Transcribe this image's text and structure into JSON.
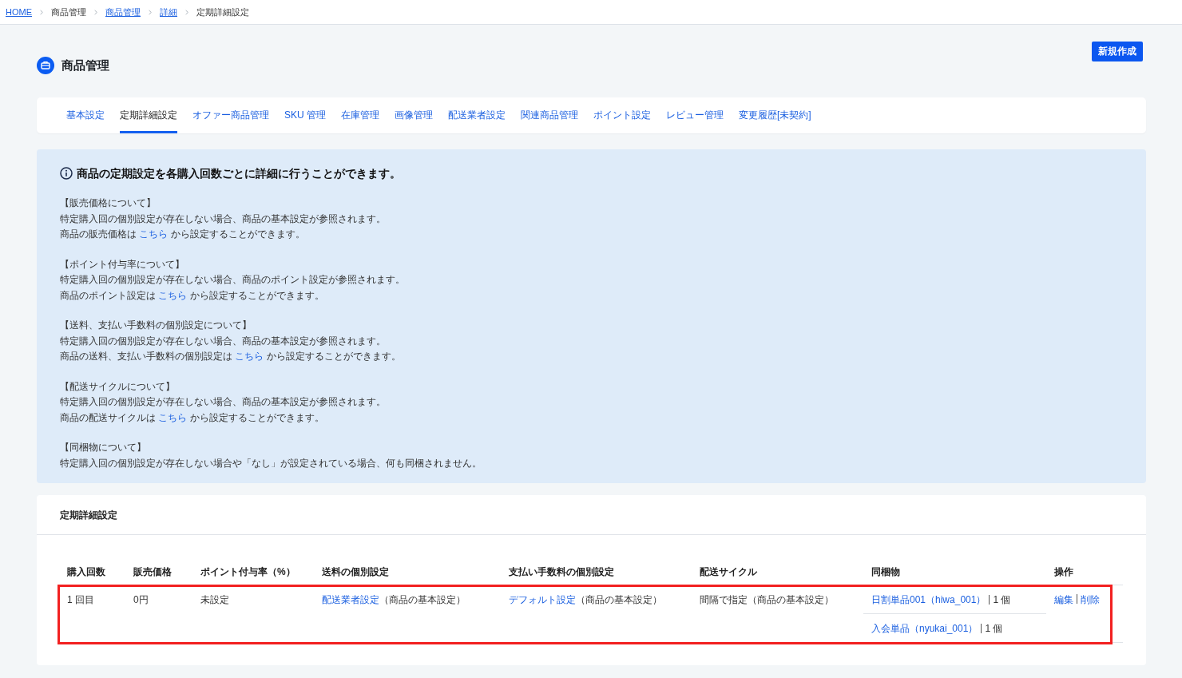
{
  "breadcrumb": [
    {
      "label": "HOME",
      "kind": "link"
    },
    {
      "label": "商品管理",
      "kind": "text"
    },
    {
      "label": "商品管理",
      "kind": "link"
    },
    {
      "label": "詳細",
      "kind": "link"
    },
    {
      "label": "定期詳細設定",
      "kind": "text"
    }
  ],
  "page_header": {
    "title": "商品管理",
    "button": "新規作成"
  },
  "tabs": [
    {
      "label": "基本設定",
      "selected": false
    },
    {
      "label": "定期詳細設定",
      "selected": true
    },
    {
      "label": "オファー商品管理",
      "selected": false
    },
    {
      "label": "SKU 管理",
      "selected": false
    },
    {
      "label": "在庫管理",
      "selected": false
    },
    {
      "label": "画像管理",
      "selected": false
    },
    {
      "label": "配送業者設定",
      "selected": false
    },
    {
      "label": "関連商品管理",
      "selected": false
    },
    {
      "label": "ポイント設定",
      "selected": false
    },
    {
      "label": "レビュー管理",
      "selected": false
    },
    {
      "label": "変更履歴[未契約]",
      "selected": false
    }
  ],
  "notice": {
    "heading": "商品の定期設定を各購入回数ごとに詳細に行うことができます。",
    "sections": [
      {
        "title": "【販売価格について】",
        "lines": [
          {
            "kind": "plain",
            "text": "特定購入回の個別設定が存在しない場合、商品の基本設定が参照されます。"
          },
          {
            "kind": "link",
            "before": "商品の販売価格は",
            "link": "こちら",
            "after": "から設定することができます。"
          }
        ]
      },
      {
        "title": "【ポイント付与率について】",
        "lines": [
          {
            "kind": "plain",
            "text": "特定購入回の個別設定が存在しない場合、商品のポイント設定が参照されます。"
          },
          {
            "kind": "link",
            "before": "商品のポイント設定は",
            "link": "こちら",
            "after": "から設定することができます。"
          }
        ]
      },
      {
        "title": "【送料、支払い手数料の個別設定について】",
        "lines": [
          {
            "kind": "plain",
            "text": "特定購入回の個別設定が存在しない場合、商品の基本設定が参照されます。"
          },
          {
            "kind": "link",
            "before": "商品の送料、支払い手数料の個別設定は",
            "link": "こちら",
            "after": "から設定することができます。"
          }
        ]
      },
      {
        "title": "【配送サイクルについて】",
        "lines": [
          {
            "kind": "plain",
            "text": "特定購入回の個別設定が存在しない場合、商品の基本設定が参照されます。"
          },
          {
            "kind": "link",
            "before": "商品の配送サイクルは",
            "link": "こちら",
            "after": "から設定することができます。"
          }
        ]
      },
      {
        "title": "【同梱物について】",
        "lines": [
          {
            "kind": "plain",
            "text": "特定購入回の個別設定が存在しない場合や「なし」が設定されている場合、何も同梱されません。"
          }
        ]
      }
    ]
  },
  "detail": {
    "title": "定期詳細設定",
    "table": {
      "columns": [
        "購入回数",
        "販売価格",
        "ポイント付与率（%）",
        "送料の個別設定",
        "支払い手数料の個別設定",
        "配送サイクル",
        "同梱物",
        "操作"
      ],
      "rows": [
        {
          "highlighted": true,
          "purchase_count": "1 回目",
          "price": "0円",
          "point_rate": "未設定",
          "shipping": {
            "link": "配送業者設定",
            "note": "（商品の基本設定）"
          },
          "payment_fee": {
            "link": "デフォルト設定",
            "note": "（商品の基本設定）"
          },
          "delivery_cycle": "間隔で指定（商品の基本設定）",
          "bundled": [
            {
              "name": "日割単品001（hiwa_001）",
              "quantity": "1 個"
            },
            {
              "name": "入会単品（nyukai_001）",
              "quantity": "1 個"
            }
          ],
          "actions": [
            "編集",
            "削除"
          ]
        }
      ]
    }
  }
}
